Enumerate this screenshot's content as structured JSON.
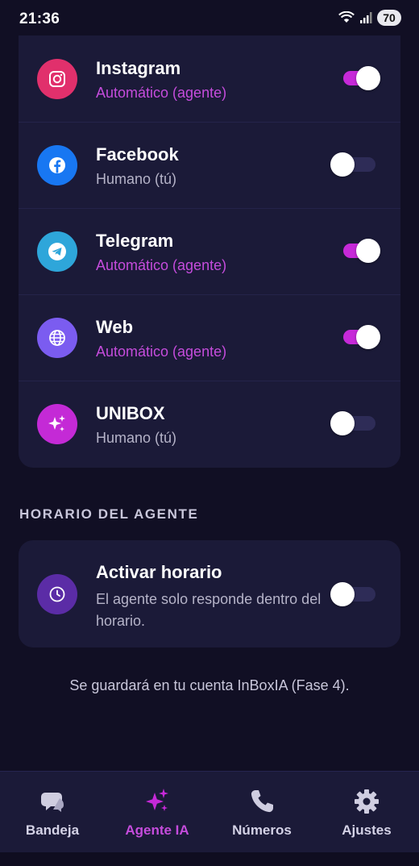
{
  "status_bar": {
    "time": "21:36",
    "battery": "70"
  },
  "channels": [
    {
      "name": "Instagram",
      "mode": "Automático (agente)",
      "enabled": true,
      "icon": "instagram-icon",
      "color": "#e1306c"
    },
    {
      "name": "Facebook",
      "mode": "Humano (tú)",
      "enabled": false,
      "icon": "facebook-icon",
      "color": "#1877f2"
    },
    {
      "name": "Telegram",
      "mode": "Automático (agente)",
      "enabled": true,
      "icon": "telegram-icon",
      "color": "#2ea6da"
    },
    {
      "name": "Web",
      "mode": "Automático (agente)",
      "enabled": true,
      "icon": "globe-icon",
      "color": "#7b5cf0"
    },
    {
      "name": "UNIBOX",
      "mode": "Humano (tú)",
      "enabled": false,
      "icon": "sparkles-icon",
      "color": "#c42ad6"
    }
  ],
  "schedule_section": {
    "label": "HORARIO DEL AGENTE",
    "title": "Activar horario",
    "description": "El agente solo responde dentro del horario.",
    "enabled": false,
    "icon": "clock-icon"
  },
  "footer_note": "Se guardará en tu cuenta InBoxIA (Fase 4).",
  "nav": {
    "items": [
      {
        "label": "Bandeja",
        "icon": "chat-bubbles-icon"
      },
      {
        "label": "Agente IA",
        "icon": "sparkles-icon"
      },
      {
        "label": "Números",
        "icon": "phone-icon"
      },
      {
        "label": "Ajustes",
        "icon": "gear-icon"
      }
    ],
    "active_index": 1
  },
  "colors": {
    "accent": "#c629d8",
    "background": "#110f24",
    "card": "#1b1a38"
  }
}
